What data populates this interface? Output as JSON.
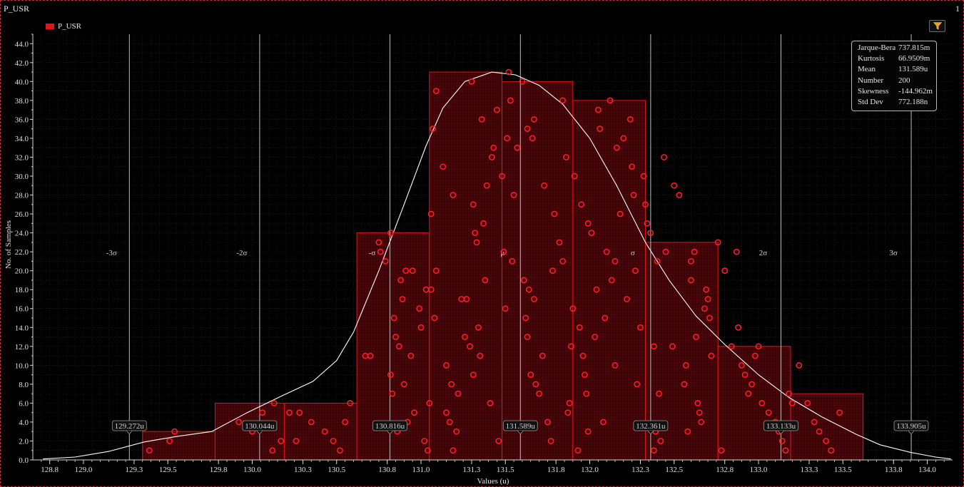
{
  "window": {
    "title": "P_USR",
    "page_number": "1"
  },
  "legend": {
    "label": "P_USR"
  },
  "stats": [
    {
      "key": "Jarque-Bera",
      "value": "737.815m"
    },
    {
      "key": "Kurtosis",
      "value": "66.9509m"
    },
    {
      "key": "Mean",
      "value": "131.589u"
    },
    {
      "key": "Number",
      "value": "200"
    },
    {
      "key": "Skewness",
      "value": "-144.962m"
    },
    {
      "key": "Std Dev",
      "value": "772.188n"
    }
  ],
  "colors": {
    "bar": "#e0141e",
    "curve": "#ffffff",
    "sigma_line": "#bdbdbd",
    "background": "#000000"
  },
  "icons": {
    "filter": "filter-icon"
  },
  "chart_data": {
    "type": "bar",
    "subtype": "histogram",
    "xlabel": "Values (u)",
    "ylabel": "No. of Samples",
    "xlim": [
      128.7,
      134.15
    ],
    "ylim": [
      0,
      45
    ],
    "x_ticks": [
      128.8,
      129.0,
      129.3,
      129.5,
      129.8,
      130.0,
      130.3,
      130.5,
      130.8,
      131.0,
      131.3,
      131.5,
      131.8,
      132.0,
      132.3,
      132.5,
      132.8,
      133.0,
      133.3,
      133.5,
      133.8,
      134.0
    ],
    "x_tick_labels": [
      "128.8",
      "129.0",
      "129.3",
      "129.5",
      "129.8",
      "130.0",
      "130.3",
      "130.5",
      "130.8",
      "131.0",
      "131.3",
      "131.5",
      "131.8",
      "132.0",
      "132.3",
      "132.5",
      "132.8",
      "133.0",
      "133.3",
      "133.5",
      "133.8",
      "134.0"
    ],
    "y_ticks": [
      0,
      2,
      4,
      6,
      8,
      10,
      12,
      14,
      16,
      18,
      20,
      22,
      24,
      26,
      28,
      30,
      32,
      34,
      36,
      38,
      40,
      42,
      44
    ],
    "y_tick_labels": [
      "0.0",
      "2.0",
      "4.0",
      "6.0",
      "8.0",
      "10.0",
      "12.0",
      "14.0",
      "16.0",
      "18.0",
      "20.0",
      "22.0",
      "24.0",
      "26.0",
      "28.0",
      "30.0",
      "32.0",
      "34.0",
      "36.0",
      "38.0",
      "40.0",
      "42.0",
      "44.0"
    ],
    "bins": [
      {
        "x0": 129.35,
        "x1": 129.78,
        "count": 3
      },
      {
        "x0": 129.78,
        "x1": 130.19,
        "count": 6
      },
      {
        "x0": 130.19,
        "x1": 130.62,
        "count": 6
      },
      {
        "x0": 130.62,
        "x1": 131.05,
        "count": 24
      },
      {
        "x0": 131.05,
        "x1": 131.48,
        "count": 41
      },
      {
        "x0": 131.48,
        "x1": 131.9,
        "count": 40
      },
      {
        "x0": 131.9,
        "x1": 132.33,
        "count": 38
      },
      {
        "x0": 132.33,
        "x1": 132.76,
        "count": 23
      },
      {
        "x0": 132.76,
        "x1": 133.19,
        "count": 12
      },
      {
        "x0": 133.19,
        "x1": 133.62,
        "count": 7
      }
    ],
    "sigma_lines": [
      {
        "x": 129.272,
        "label": "-3σ",
        "value_label": "129.272u"
      },
      {
        "x": 130.044,
        "label": "-2σ",
        "value_label": "130.044u"
      },
      {
        "x": 130.816,
        "label": "-σ",
        "value_label": "130.816u"
      },
      {
        "x": 131.589,
        "label": "μ",
        "value_label": "131.589u"
      },
      {
        "x": 132.361,
        "label": "σ",
        "value_label": "132.361u"
      },
      {
        "x": 133.133,
        "label": "2σ",
        "value_label": "133.133u"
      },
      {
        "x": 133.905,
        "label": "3σ",
        "value_label": "133.905u"
      }
    ],
    "curve": [
      [
        128.76,
        0.1
      ],
      [
        128.95,
        0.3
      ],
      [
        129.15,
        0.9
      ],
      [
        129.36,
        1.9
      ],
      [
        129.56,
        2.5
      ],
      [
        129.76,
        3.0
      ],
      [
        129.97,
        5.0
      ],
      [
        130.18,
        6.8
      ],
      [
        130.36,
        8.3
      ],
      [
        130.5,
        10.5
      ],
      [
        130.6,
        13.5
      ],
      [
        130.75,
        20.0
      ],
      [
        130.9,
        27.0
      ],
      [
        131.03,
        33.2
      ],
      [
        131.13,
        37.2
      ],
      [
        131.26,
        40.0
      ],
      [
        131.42,
        41.0
      ],
      [
        131.56,
        40.7
      ],
      [
        131.7,
        39.6
      ],
      [
        131.84,
        37.6
      ],
      [
        132.0,
        34.0
      ],
      [
        132.16,
        29.0
      ],
      [
        132.33,
        23.0
      ],
      [
        132.47,
        19.0
      ],
      [
        132.63,
        15.2
      ],
      [
        132.8,
        12.2
      ],
      [
        133.0,
        9.0
      ],
      [
        133.18,
        6.6
      ],
      [
        133.38,
        4.5
      ],
      [
        133.58,
        2.7
      ],
      [
        133.72,
        1.6
      ],
      [
        133.9,
        0.8
      ],
      [
        134.05,
        0.3
      ],
      [
        134.14,
        0.1
      ]
    ],
    "samples": [
      [
        129.39,
        1
      ],
      [
        129.51,
        2
      ],
      [
        129.54,
        3
      ],
      [
        129.92,
        4
      ],
      [
        130.06,
        5
      ],
      [
        130.12,
        1
      ],
      [
        130.13,
        6
      ],
      [
        130.17,
        2
      ],
      [
        130.26,
        2
      ],
      [
        130.28,
        5
      ],
      [
        130.43,
        3
      ],
      [
        130.52,
        1
      ],
      [
        130.55,
        4
      ],
      [
        130.58,
        6
      ],
      [
        130.67,
        11
      ],
      [
        130.75,
        23
      ],
      [
        130.76,
        22
      ],
      [
        130.79,
        21
      ],
      [
        130.82,
        24
      ],
      [
        130.82,
        9
      ],
      [
        130.83,
        7
      ],
      [
        130.84,
        15
      ],
      [
        130.85,
        13
      ],
      [
        130.86,
        3
      ],
      [
        130.87,
        12
      ],
      [
        130.88,
        19
      ],
      [
        130.89,
        17
      ],
      [
        130.9,
        8
      ],
      [
        130.91,
        20
      ],
      [
        130.92,
        4
      ],
      [
        130.94,
        11
      ],
      [
        130.96,
        5
      ],
      [
        130.99,
        16
      ],
      [
        131.0,
        14
      ],
      [
        131.02,
        2
      ],
      [
        131.04,
        1
      ],
      [
        131.03,
        18
      ],
      [
        131.05,
        6
      ],
      [
        131.06,
        18
      ],
      [
        131.06,
        26
      ],
      [
        131.07,
        35
      ],
      [
        131.08,
        15
      ],
      [
        131.09,
        39
      ],
      [
        131.09,
        20
      ],
      [
        131.13,
        31
      ],
      [
        131.15,
        10
      ],
      [
        131.15,
        5
      ],
      [
        131.17,
        4
      ],
      [
        131.18,
        8
      ],
      [
        131.19,
        1
      ],
      [
        131.19,
        28
      ],
      [
        131.21,
        3
      ],
      [
        131.22,
        7
      ],
      [
        131.24,
        17
      ],
      [
        131.26,
        13
      ],
      [
        131.29,
        12
      ],
      [
        131.3,
        40
      ],
      [
        131.31,
        27
      ],
      [
        131.31,
        9
      ],
      [
        131.32,
        24
      ],
      [
        131.33,
        23
      ],
      [
        131.34,
        14
      ],
      [
        131.35,
        11
      ],
      [
        131.36,
        36
      ],
      [
        131.37,
        25
      ],
      [
        131.38,
        19
      ],
      [
        131.39,
        29
      ],
      [
        131.41,
        6
      ],
      [
        131.42,
        32
      ],
      [
        131.43,
        33
      ],
      [
        131.45,
        37
      ],
      [
        131.46,
        2
      ],
      [
        131.48,
        30
      ],
      [
        131.49,
        22
      ],
      [
        131.5,
        16
      ],
      [
        131.51,
        34
      ],
      [
        131.52,
        41
      ],
      [
        131.53,
        38
      ],
      [
        131.54,
        21
      ],
      [
        131.57,
        33
      ],
      [
        131.6,
        40
      ],
      [
        131.61,
        19
      ],
      [
        131.62,
        15
      ],
      [
        131.63,
        35
      ],
      [
        131.63,
        13
      ],
      [
        131.64,
        18
      ],
      [
        131.65,
        9
      ],
      [
        131.66,
        34
      ],
      [
        131.67,
        36
      ],
      [
        131.67,
        17
      ],
      [
        131.68,
        8
      ],
      [
        131.7,
        7
      ],
      [
        131.72,
        11
      ],
      [
        131.73,
        29
      ],
      [
        131.75,
        4
      ],
      [
        131.77,
        2
      ],
      [
        131.78,
        20
      ],
      [
        131.79,
        26
      ],
      [
        131.84,
        21
      ],
      [
        131.84,
        38
      ],
      [
        131.86,
        32
      ],
      [
        131.87,
        5
      ],
      [
        131.88,
        6
      ],
      [
        131.89,
        12
      ],
      [
        131.9,
        16
      ],
      [
        131.91,
        30
      ],
      [
        131.93,
        1
      ],
      [
        131.94,
        14
      ],
      [
        131.95,
        27
      ],
      [
        131.96,
        11
      ],
      [
        131.97,
        9
      ],
      [
        131.98,
        7
      ],
      [
        131.99,
        3
      ],
      [
        131.99,
        25
      ],
      [
        132.01,
        24
      ],
      [
        132.03,
        13
      ],
      [
        132.04,
        18
      ],
      [
        132.05,
        37
      ],
      [
        132.06,
        35
      ],
      [
        132.08,
        4
      ],
      [
        132.09,
        15
      ],
      [
        132.1,
        22
      ],
      [
        132.12,
        38
      ],
      [
        132.13,
        19
      ],
      [
        132.15,
        10
      ],
      [
        132.16,
        33
      ],
      [
        132.18,
        26
      ],
      [
        132.2,
        34
      ],
      [
        132.22,
        17
      ],
      [
        132.24,
        36
      ],
      [
        132.25,
        31
      ],
      [
        132.26,
        28
      ],
      [
        132.27,
        20
      ],
      [
        132.28,
        8
      ],
      [
        132.3,
        14
      ],
      [
        132.32,
        30
      ],
      [
        132.33,
        27
      ],
      [
        132.34,
        25
      ],
      [
        132.36,
        24
      ],
      [
        132.38,
        12
      ],
      [
        132.38,
        1
      ],
      [
        132.39,
        3
      ],
      [
        132.4,
        21
      ],
      [
        132.41,
        7
      ],
      [
        132.42,
        2
      ],
      [
        132.44,
        32
      ],
      [
        132.45,
        22
      ],
      [
        132.5,
        29
      ],
      [
        132.53,
        28
      ],
      [
        132.56,
        8
      ],
      [
        132.57,
        10
      ],
      [
        132.58,
        3
      ],
      [
        132.6,
        21
      ],
      [
        132.6,
        19
      ],
      [
        132.62,
        22
      ],
      [
        132.63,
        13
      ],
      [
        132.64,
        6
      ],
      [
        132.65,
        5
      ],
      [
        132.66,
        4
      ],
      [
        132.68,
        16
      ],
      [
        132.69,
        18
      ],
      [
        132.7,
        17
      ],
      [
        132.71,
        15
      ],
      [
        132.72,
        11
      ],
      [
        132.76,
        23
      ],
      [
        132.78,
        1
      ],
      [
        132.8,
        20
      ],
      [
        132.84,
        12
      ],
      [
        132.87,
        22
      ],
      [
        132.88,
        14
      ],
      [
        132.9,
        10
      ],
      [
        132.92,
        9
      ],
      [
        132.94,
        7
      ],
      [
        132.96,
        8
      ],
      [
        132.98,
        11
      ],
      [
        133.0,
        12
      ],
      [
        133.02,
        6
      ],
      [
        133.06,
        5
      ],
      [
        133.1,
        4
      ],
      [
        133.12,
        3
      ],
      [
        133.14,
        2
      ],
      [
        133.16,
        1
      ],
      [
        133.18,
        7
      ],
      [
        133.2,
        6
      ],
      [
        133.24,
        10
      ],
      [
        133.29,
        6
      ],
      [
        133.33,
        4
      ],
      [
        133.36,
        3
      ],
      [
        133.4,
        2
      ],
      [
        133.43,
        1
      ],
      [
        133.48,
        5
      ],
      [
        130.0,
        3
      ],
      [
        130.22,
        5
      ],
      [
        130.35,
        4
      ],
      [
        130.48,
        2
      ],
      [
        130.7,
        11
      ],
      [
        130.95,
        20
      ],
      [
        131.27,
        17
      ],
      [
        131.55,
        28
      ],
      [
        131.82,
        23
      ],
      [
        132.15,
        21
      ],
      [
        132.49,
        12
      ]
    ]
  }
}
